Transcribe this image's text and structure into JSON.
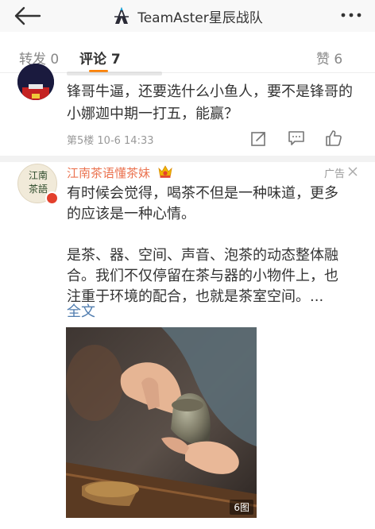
{
  "header": {
    "title": "TeamAster星辰战队"
  },
  "tabs": [
    {
      "label": "转发 0"
    },
    {
      "label": "评论 7"
    },
    {
      "label": "赞 6"
    }
  ],
  "comment": {
    "text": "锋哥牛逼，还要选什么小鱼人，要不是锋哥的小娜迦中期一打五，能赢？",
    "meta": "第5楼 10-6 14:33"
  },
  "ad": {
    "name": "江南茶语懂茶妹",
    "avatar_text_1": "江南",
    "avatar_text_2": "茶語",
    "tag": "广告",
    "paragraph_1": "有时候会觉得，喝茶不但是一种味道，更多的应该是一种心情。",
    "paragraph_2": "是茶、器、空间、声音、泡茶的动态整体融合。我们不仅停留在茶与器的小物件上，也注重于环境的配合，也就是茶室空间。...",
    "full_text_link": "全文",
    "photo_count": "6图"
  },
  "colors": {
    "accent_orange": "#ff8200",
    "ad_name": "#eb7350",
    "link_blue": "#507daf",
    "meta_gray": "#999999"
  },
  "icons": {
    "back": "arrow-left-icon",
    "logo": "team-aster-logo",
    "more": "more-dots-icon",
    "share": "share-edit-icon",
    "reply": "comment-icon",
    "like": "thumbs-up-icon",
    "crown": "vip-crown-icon",
    "close": "close-icon"
  }
}
